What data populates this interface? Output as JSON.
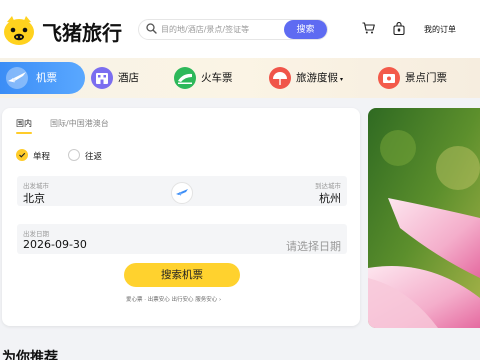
{
  "brand": {
    "name": "飞猪旅行"
  },
  "search": {
    "placeholder": "目的地/酒店/景点/签证等",
    "button": "搜索"
  },
  "header": {
    "my_orders": "我的订单",
    "cart_icon": "cart-icon",
    "lock_icon": "bag-icon"
  },
  "nav": {
    "items": [
      {
        "label": "机票",
        "icon": "plane-icon",
        "active": true
      },
      {
        "label": "酒店",
        "icon": "hotel-icon",
        "active": false
      },
      {
        "label": "火车票",
        "icon": "train-icon",
        "active": false
      },
      {
        "label": "旅游度假",
        "icon": "vacation-icon",
        "active": false,
        "caret": "▾"
      },
      {
        "label": "景点门票",
        "icon": "ticket-icon",
        "active": false
      }
    ]
  },
  "booking": {
    "tabs": [
      "国内",
      "国际/中国港澳台"
    ],
    "trip_types": [
      {
        "label": "单程",
        "checked": true
      },
      {
        "label": "往返",
        "checked": false
      }
    ],
    "from_caption": "出发城市",
    "from_value": "北京",
    "to_caption": "到达城市",
    "to_value": "杭州",
    "depart_caption": "出发日期",
    "depart_value": "2026-09-30",
    "return_placeholder": "请选择日期",
    "submit": "搜索机票",
    "assurance": "爱心票 · 出票安心 出行安心 服务安心 ›"
  },
  "section": {
    "title": "为你推荐"
  },
  "colors": {
    "accent_yellow": "#ffd22e",
    "accent_blue": "#3b8df6",
    "search_button": "#5e6bf2"
  }
}
